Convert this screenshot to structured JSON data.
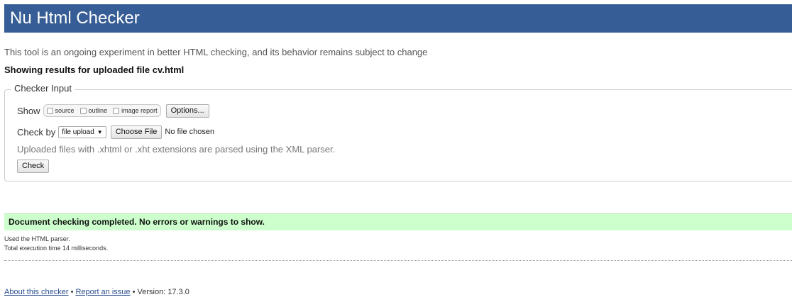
{
  "header": {
    "title": "Nu Html Checker"
  },
  "intro_text": "This tool is an ongoing experiment in better HTML checking, and its behavior remains subject to change",
  "showing_results": "Showing results for uploaded file cv.html",
  "checker_input": {
    "legend": "Checker Input",
    "show_label": "Show",
    "show_options": [
      {
        "label": "source",
        "checked": false
      },
      {
        "label": "outline",
        "checked": false
      },
      {
        "label": "image report",
        "checked": false
      }
    ],
    "options_button": "Options...",
    "check_by_label": "Check by",
    "check_by_value": "file upload",
    "choose_file_button": "Choose File",
    "file_status": "No file chosen",
    "xml_note": "Uploaded files with .xhtml or .xht extensions are parsed using the XML parser.",
    "check_button": "Check"
  },
  "result": {
    "message": "Document checking completed. No errors or warnings to show.",
    "parser_line": "Used the HTML parser.",
    "time_line": "Total execution time 14 milliseconds."
  },
  "footer": {
    "about_link": "About this checker",
    "separator": "•",
    "report_link": "Report an issue",
    "version_text": "Version: 17.3.0"
  },
  "colors": {
    "header_bg": "#365d95",
    "success_bg": "#ccffcc",
    "link": "#2a4f8f"
  }
}
